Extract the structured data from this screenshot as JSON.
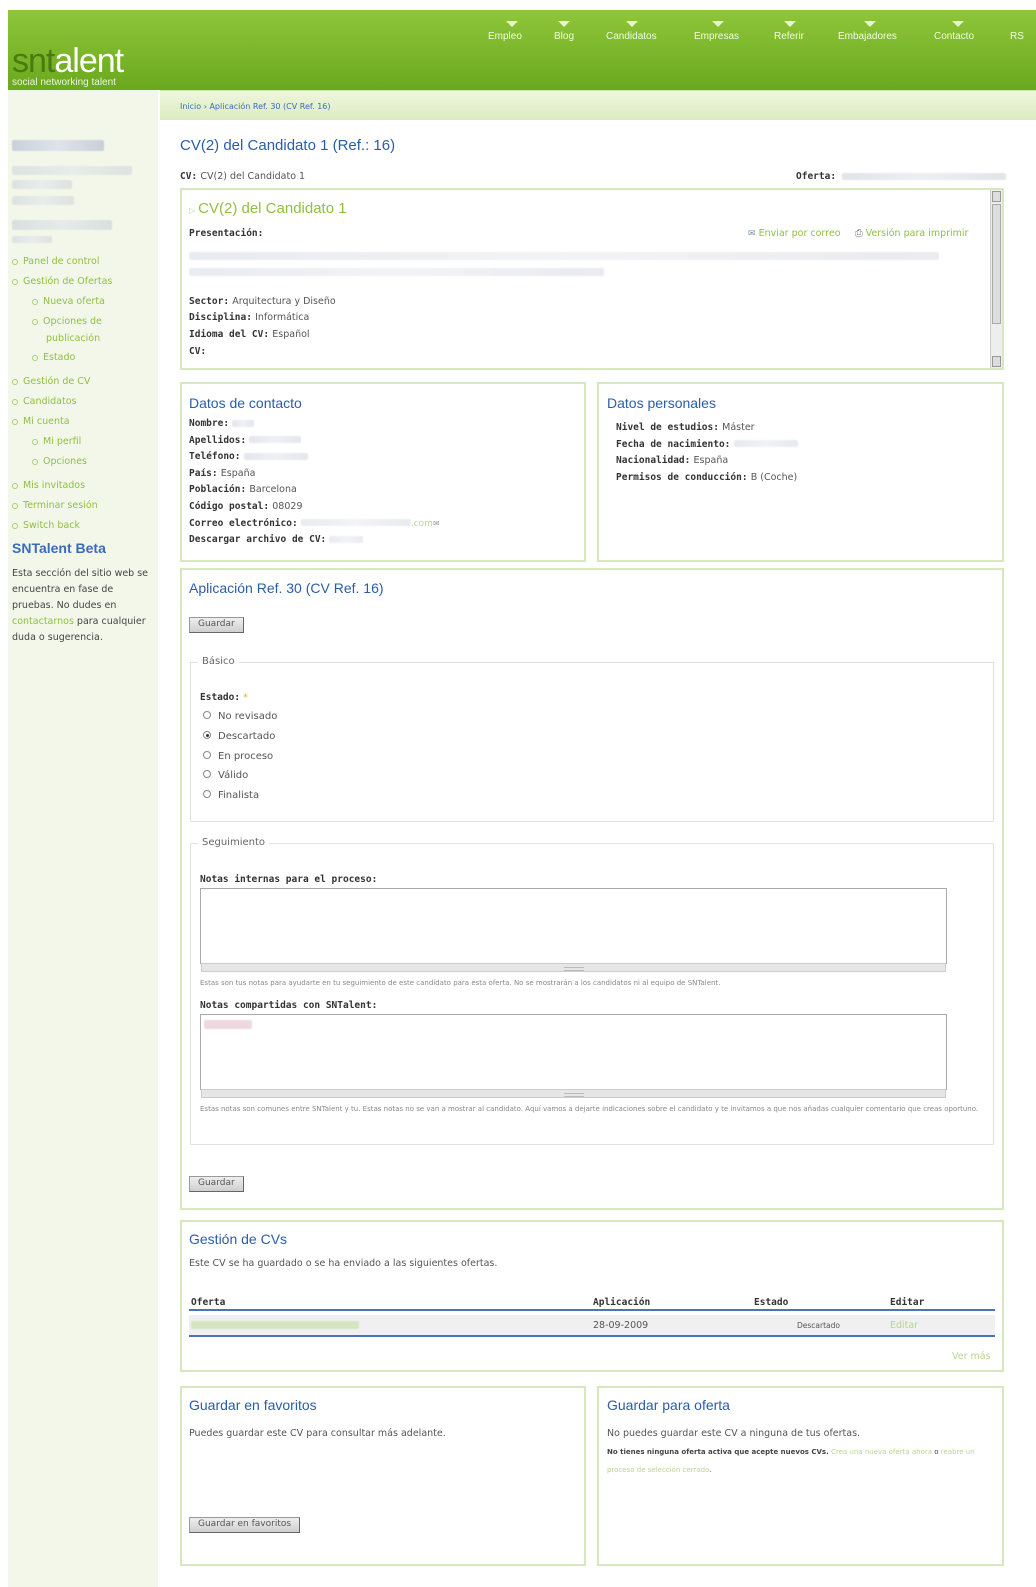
{
  "logo": {
    "text_a": "snt",
    "text_b": "alent",
    "tagline": "social networking talent"
  },
  "nav": [
    "Empleo",
    "Blog",
    "Candidatos",
    "Empresas",
    "Referir",
    "Embajadores",
    "Contacto",
    "RS"
  ],
  "breadcrumb": "Inicio › Aplicación Ref. 30 (CV Ref. 16)",
  "sidebar": {
    "links": [
      "Panel de control",
      "Gestión de Ofertas",
      "Nueva oferta",
      "Opciones de",
      "publicación",
      "Estado",
      "Gestión de CV",
      "Candidatos",
      "Mi cuenta",
      "Mi perfil",
      "Opciones",
      "Mis invitados",
      "Terminar sesión",
      "Switch back"
    ],
    "beta_title": "SNTalent Beta",
    "beta_text_a": "Esta sección del sitio web se encuentra en fase de pruebas. No dudes en ",
    "beta_link": "contactarnos",
    "beta_text_b": " para cualquier duda o sugerencia."
  },
  "page_title": "CV(2) del Candidato 1 (Ref.: 16)",
  "cv_line": {
    "label": "CV:",
    "value": "CV(2) del Candidato 1",
    "offer_label": "Oferta:"
  },
  "cv_box": {
    "title": "CV(2) del Candidato 1",
    "presentacion": "Presentación:",
    "email_link": "Enviar por correo",
    "print_link": "Versión para imprimir",
    "sector_label": "Sector:",
    "sector": "Arquitectura y Diseño",
    "disciplina_label": "Disciplina:",
    "disciplina": "Informática",
    "idioma_label": "Idioma del CV:",
    "idioma": "Español",
    "cv_label": "CV:"
  },
  "contacto": {
    "title": "Datos de contacto",
    "nombre": "Nombre:",
    "apellidos": "Apellidos:",
    "telefono": "Teléfono:",
    "pais_label": "País:",
    "pais": "España",
    "poblacion_label": "Población:",
    "poblacion": "Barcelona",
    "cp_label": "Código postal:",
    "cp": "08029",
    "correo_label": "Correo electrónico:",
    "correo_tail": ".com",
    "descargar": "Descargar archivo de CV:"
  },
  "personales": {
    "title": "Datos personales",
    "estudios_label": "Nivel de estudios:",
    "estudios": "Máster",
    "nacimiento_label": "Fecha de nacimiento:",
    "nacionalidad_label": "Nacionalidad:",
    "nacionalidad": "España",
    "permisos_label": "Permisos de conducción:",
    "permisos": "B (Coche)"
  },
  "aplicacion": {
    "title": "Aplicación Ref. 30 (CV Ref. 16)",
    "save": "Guardar",
    "basico": "Básico",
    "estado_label": "Estado:",
    "required": "*",
    "options": [
      "No revisado",
      "Descartado",
      "En proceso",
      "Válido",
      "Finalista"
    ],
    "selected_index": 1,
    "seguimiento": "Seguimiento",
    "notas_internas": "Notas internas para el proceso:",
    "notas_internas_help": "Estas son tus notas para ayudarte en tu seguimiento de este candidato para esta oferta. No se mostrarán a los candidatos ni al equipo de SNTalent.",
    "notas_compartidas": "Notas compartidas con SNTalent:",
    "notas_compartidas_help": "Estas notas son comunes entre SNTalent y tu. Estas notas no se van a mostrar al candidato. Aquí vamos a dejarte indicaciones sobre el candidato y te invitamos a que nos añadas cualquier comentario que creas oportuno.",
    "save2": "Guardar"
  },
  "gestion": {
    "title": "Gestión de CVs",
    "desc": "Este CV se ha guardado o se ha enviado a las siguientes ofertas.",
    "headers": [
      "Oferta",
      "Aplicación",
      "Estado",
      "Editar"
    ],
    "row": {
      "aplicacion": "28-09-2009",
      "estado": "Descartado",
      "editar": "Editar"
    },
    "ver_mas": "Ver más"
  },
  "favoritos": {
    "title": "Guardar en favoritos",
    "desc": "Puedes guardar este CV para consultar más adelante.",
    "button": "Guardar en favoritos"
  },
  "oferta": {
    "title": "Guardar para oferta",
    "desc": "No puedes guardar este CV a ninguna de tus ofertas.",
    "note_a": "No tienes ninguna oferta activa que acepte nuevos CVs.",
    "link_a": "Crea una nueva oferta ahora",
    "mid": " o ",
    "link_b": "reabre un proceso de selección cerrado",
    "end": "."
  },
  "colors": {
    "brand_green": "#7ab829",
    "link_blue": "#2a5da8",
    "link_green": "#8fbf43"
  }
}
